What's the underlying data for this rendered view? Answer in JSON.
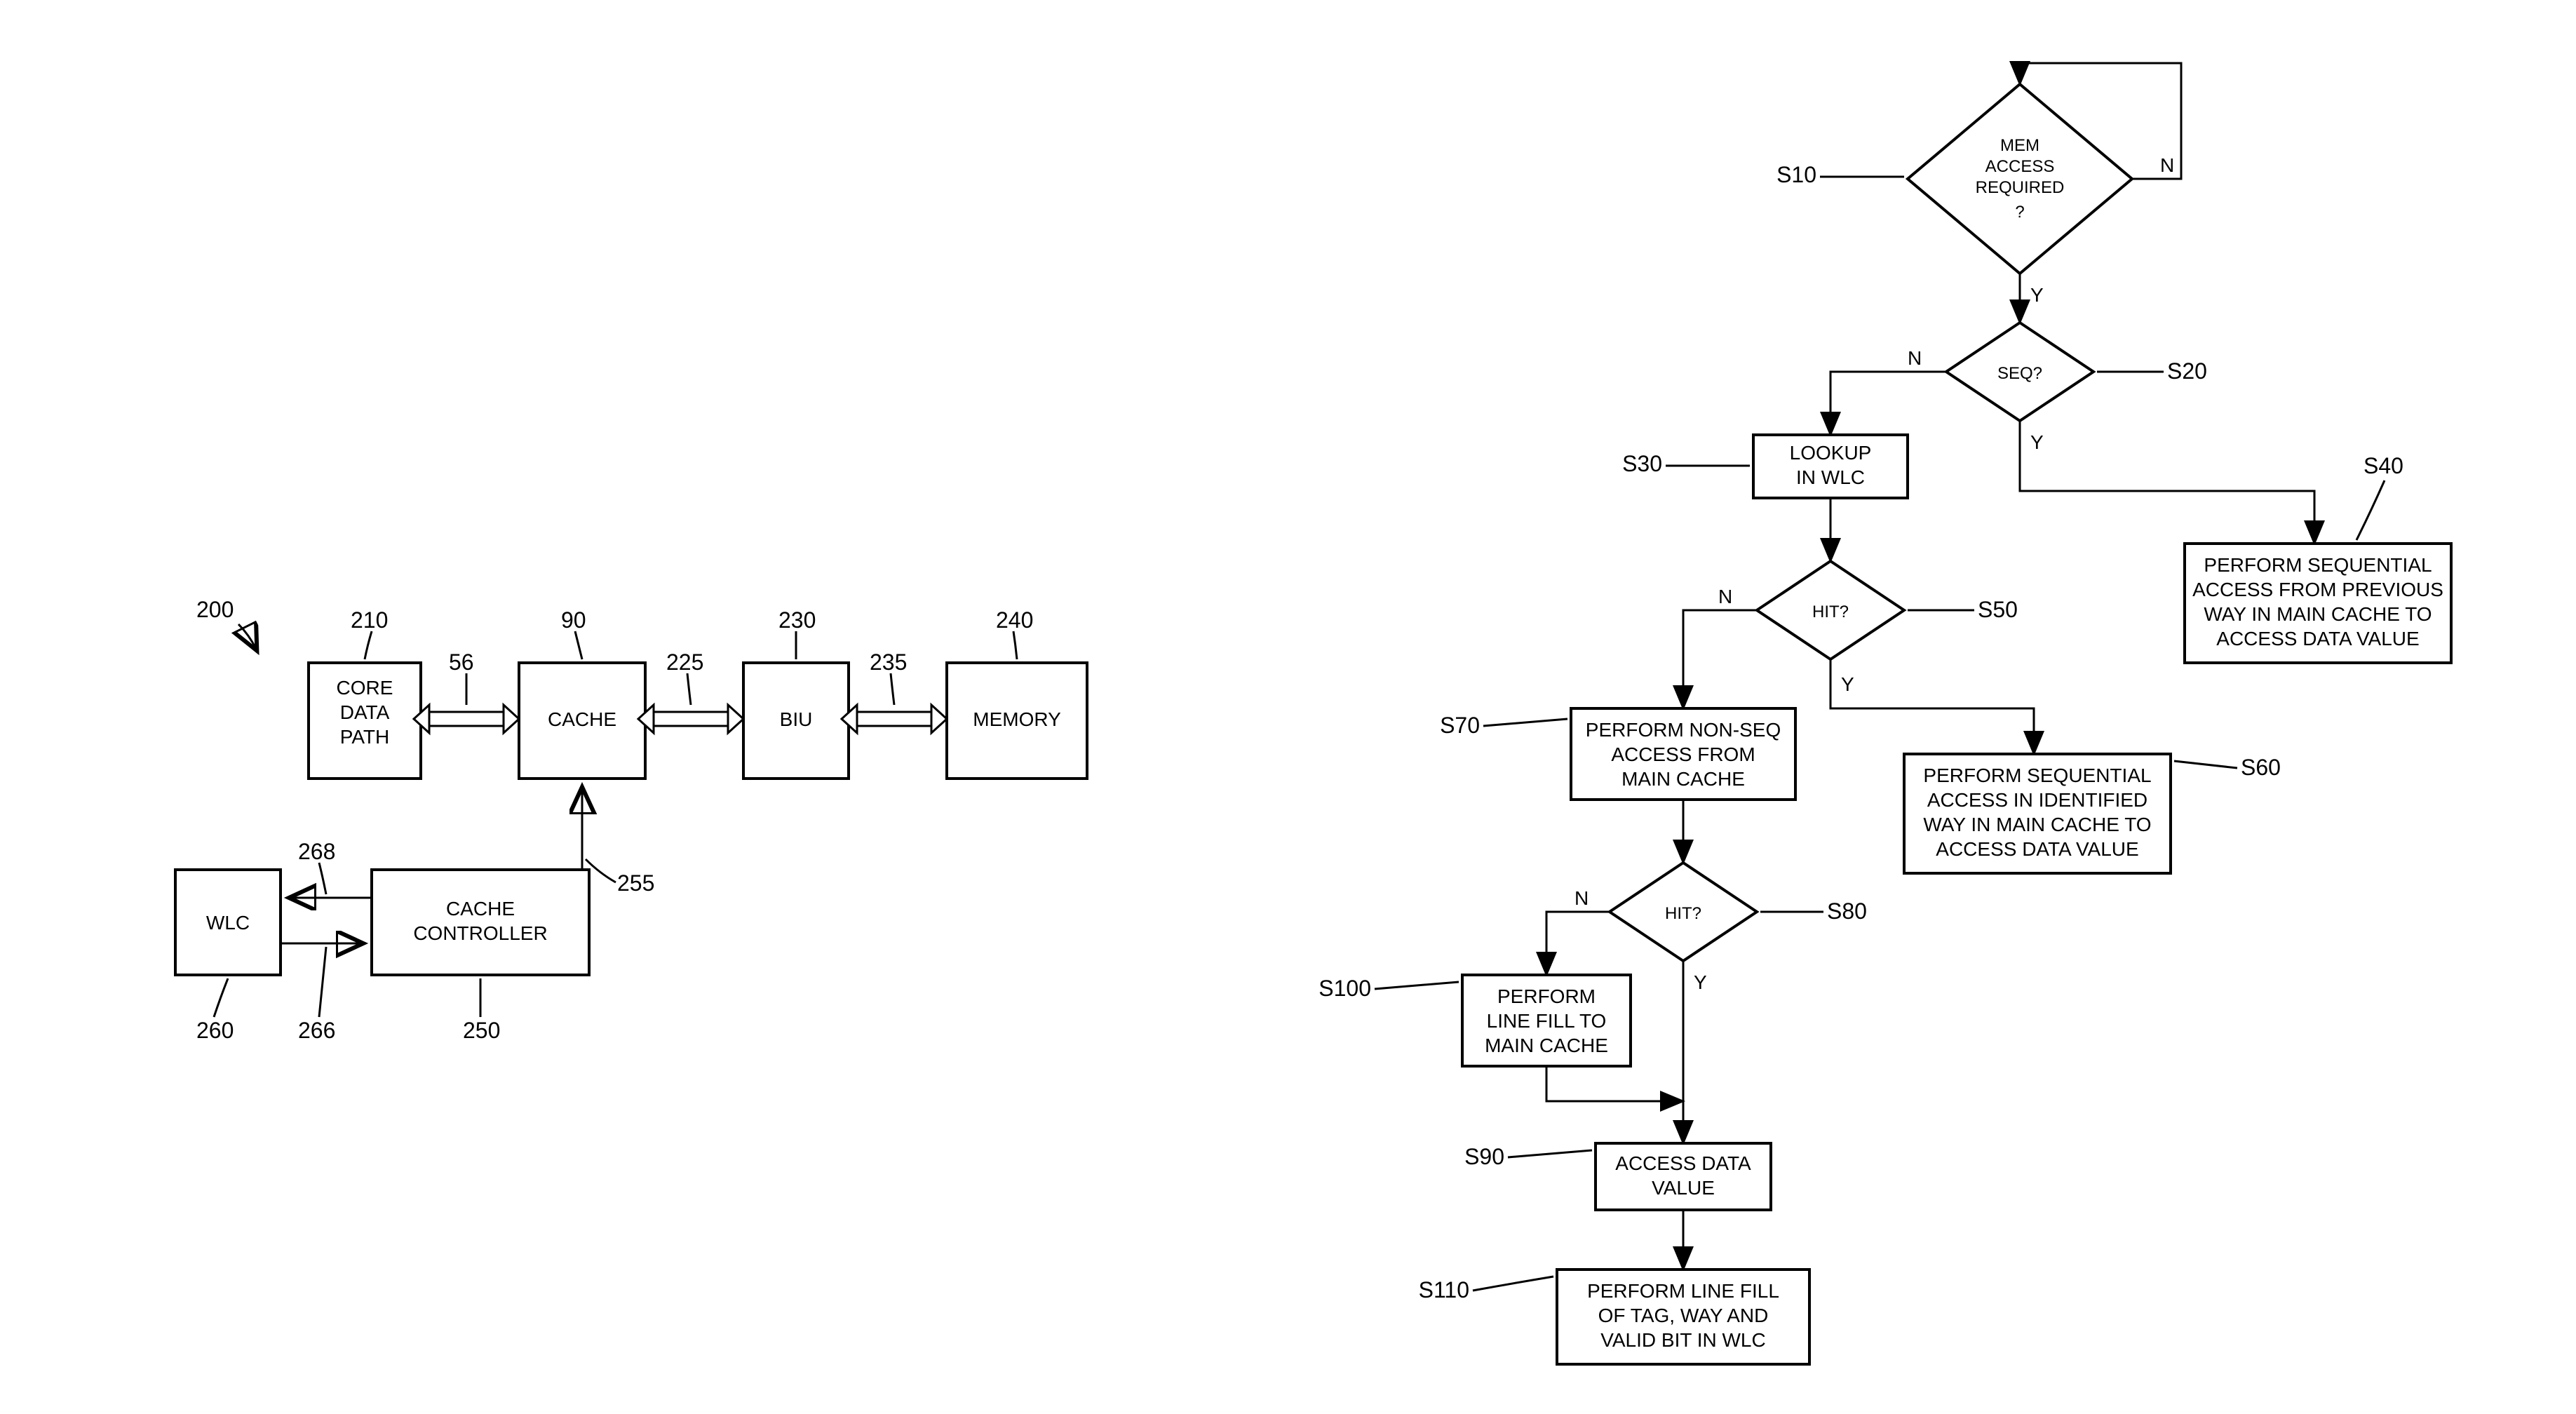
{
  "block": {
    "ref200": "200",
    "core": {
      "label1": "CORE",
      "label2": "DATA",
      "label3": "PATH",
      "ref": "210"
    },
    "bus56": "56",
    "cache": {
      "label": "CACHE",
      "ref": "90"
    },
    "bus225": "225",
    "biu": {
      "label": "BIU",
      "ref": "230"
    },
    "bus235": "235",
    "memory": {
      "label": "MEMORY",
      "ref": "240"
    },
    "wlc": {
      "label": "WLC",
      "ref260": "260",
      "ref266": "266",
      "ref268": "268"
    },
    "controller": {
      "label1": "CACHE",
      "label2": "CONTROLLER",
      "ref": "250"
    },
    "ref255": "255"
  },
  "flow": {
    "s10": {
      "ref": "S10",
      "l1": "MEM",
      "l2": "ACCESS",
      "l3": "REQUIRED",
      "l4": "?"
    },
    "s20": {
      "ref": "S20",
      "l1": "SEQ?"
    },
    "s30": {
      "ref": "S30",
      "l1": "LOOKUP",
      "l2": "IN WLC"
    },
    "s40": {
      "ref": "S40",
      "l1": "PERFORM SEQUENTIAL",
      "l2": "ACCESS FROM PREVIOUS",
      "l3": "WAY IN MAIN CACHE TO",
      "l4": "ACCESS DATA VALUE"
    },
    "s50": {
      "ref": "S50",
      "l1": "HIT?"
    },
    "s60": {
      "ref": "S60",
      "l1": "PERFORM SEQUENTIAL",
      "l2": "ACCESS IN IDENTIFIED",
      "l3": "WAY IN MAIN CACHE TO",
      "l4": "ACCESS DATA VALUE"
    },
    "s70": {
      "ref": "S70",
      "l1": "PERFORM NON-SEQ",
      "l2": "ACCESS FROM",
      "l3": "MAIN CACHE"
    },
    "s80": {
      "ref": "S80",
      "l1": "HIT?"
    },
    "s90": {
      "ref": "S90",
      "l1": "ACCESS DATA",
      "l2": "VALUE"
    },
    "s100": {
      "ref": "S100",
      "l1": "PERFORM",
      "l2": "LINE FILL TO",
      "l3": "MAIN CACHE"
    },
    "s110": {
      "ref": "S110",
      "l1": "PERFORM LINE FILL",
      "l2": "OF TAG, WAY AND",
      "l3": "VALID BIT IN WLC"
    },
    "branch": {
      "y": "Y",
      "n": "N"
    }
  }
}
